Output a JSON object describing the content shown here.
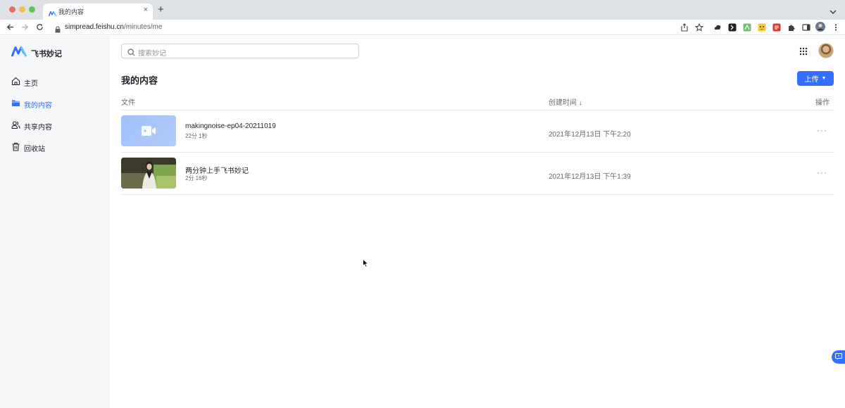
{
  "browser": {
    "tab_title": "我的内容",
    "close_symbol": "×",
    "new_tab_symbol": "+",
    "url_host": "simpread.feishu.cn",
    "url_path": "/minutes/me"
  },
  "app": {
    "logo_text": "飞书妙记",
    "accent_color": "#3370ff"
  },
  "sidebar": {
    "items": [
      {
        "label": "主页",
        "icon": "home-icon"
      },
      {
        "label": "我的内容",
        "icon": "folder-icon",
        "active": true
      },
      {
        "label": "共享内容",
        "icon": "shared-users-icon"
      },
      {
        "label": "回收站",
        "icon": "trash-icon"
      }
    ]
  },
  "search": {
    "placeholder": "搜索妙记"
  },
  "main": {
    "title": "我的内容",
    "upload_label": "上传",
    "columns": {
      "file": "文件",
      "created": "创建时间",
      "sort_arrow": "↓",
      "actions": "操作"
    },
    "rows": [
      {
        "name": "makingnoise-ep04-20211019",
        "duration": "22分 1秒",
        "created": "2021年12月13日 下午2:20",
        "thumbnail": "video-placeholder-icon"
      },
      {
        "name": "两分钟上手飞书妙记",
        "duration": "2分 16秒",
        "created": "2021年12月13日 下午1:39",
        "thumbnail": "video-frame"
      }
    ],
    "more_symbol": "···"
  }
}
